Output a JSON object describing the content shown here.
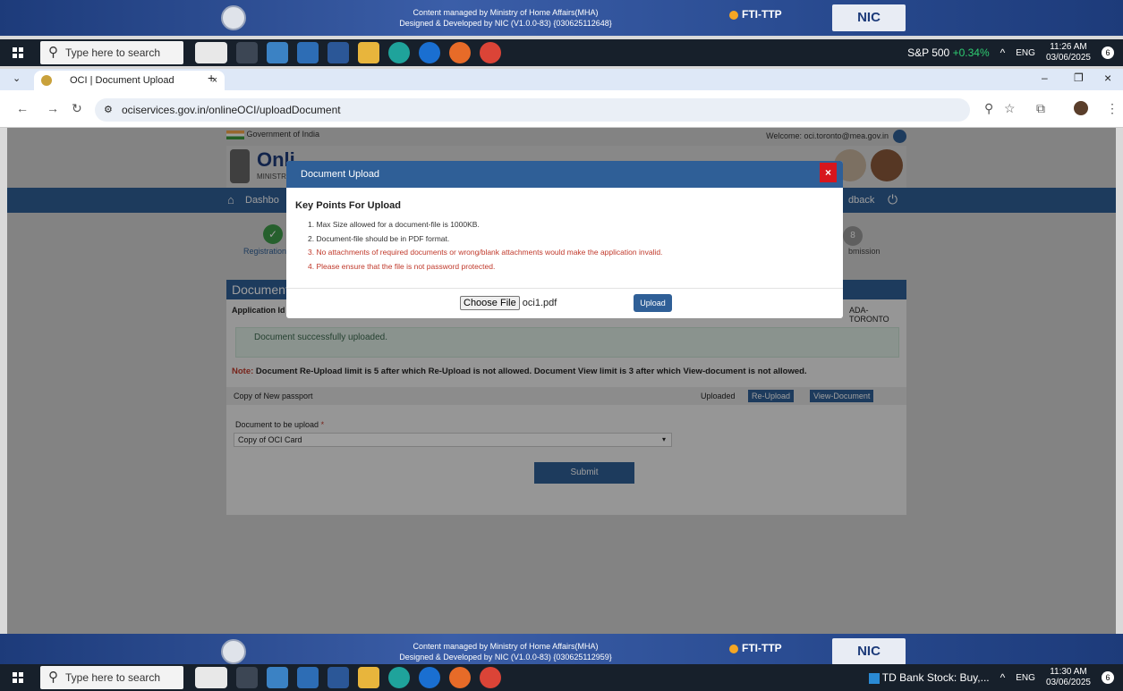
{
  "top_banner": {
    "line1": "Content managed by Ministry of Home Affairs(MHA)",
    "line2": "Designed & Developed by NIC (V1.0.0-83) {030625112648}",
    "fti": "FTI-TTP",
    "nic": "NIC"
  },
  "bottom_banner": {
    "line1": "Content managed by Ministry of Home Affairs(MHA)",
    "line2": "Designed & Developed by NIC (V1.0.0-83) {030625112959}",
    "fti": "FTI-TTP",
    "nic": "NIC"
  },
  "taskbar_top": {
    "search_placeholder": "Type here to search",
    "stock": "S&P 500",
    "stock_change": "+0.34%",
    "lang": "ENG",
    "time": "11:26 AM",
    "date": "03/06/2025",
    "badge": "6"
  },
  "taskbar_bottom": {
    "search_placeholder": "Type here to search",
    "news": "TD Bank Stock: Buy,...",
    "lang": "ENG",
    "time": "11:30 AM",
    "date": "03/06/2025",
    "badge": "6"
  },
  "browser": {
    "tab_title": "OCI | Document Upload",
    "url": "ociservices.gov.in/onlineOCI/uploadDocument"
  },
  "page": {
    "gov_label": "Government of India",
    "welcome": "Welcome: oci.toronto@mea.gov.in",
    "site_title": "Onli",
    "ministry": "MINISTR",
    "nav_home": "Dashbo",
    "nav_feedback": "dback",
    "step_registration": "Registration",
    "step_submission": "bmission",
    "step_number": "8",
    "section_title": "Document",
    "app_id_label": "Application Id",
    "mission": "ADA-TORONTO",
    "success_msg": "Document successfully uploaded.",
    "note_label": "Note:",
    "note_text": "Document Re-Upload limit is 5 after which Re-Upload is not allowed. Document View limit is 3 after which View-document is not allowed.",
    "doc_row_name": "Copy of New passport",
    "doc_row_status": "Uploaded",
    "reupload_label": "Re-Upload",
    "view_label": "View-Document",
    "select_label": "Document to be upload",
    "required_mark": "*",
    "select_value": "Copy of OCI Card",
    "submit_label": "Submit"
  },
  "modal": {
    "title": "Document Upload",
    "close": "×",
    "heading": "Key Points For Upload",
    "points": [
      "1. Max Size allowed for a document-file is 1000KB.",
      "2. Document-file should be in PDF format.",
      "3. No attachments of required documents or wrong/blank attachments would make the application invalid.",
      "4. Please ensure that the file is not password protected."
    ],
    "choose_file": "Choose File",
    "file_name": "oci1.pdf",
    "upload_label": "Upload"
  },
  "colors": {
    "primary": "#2f5f97",
    "danger": "#d7161d",
    "note_red": "#c0392b",
    "success_bg": "#dfeee6"
  }
}
